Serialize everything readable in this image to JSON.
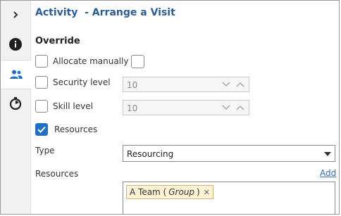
{
  "panel": {
    "title": "Activity  - Arrange a Visit",
    "section_title": "Override"
  },
  "rail": {
    "icons": [
      "chevron-right-icon",
      "info-icon",
      "people-icon",
      "stopwatch-icon"
    ],
    "active": "people-icon"
  },
  "override": {
    "allocate_manually": {
      "label": "Allocate manually",
      "checked": false
    },
    "security_level": {
      "label": "Security level",
      "checked": false,
      "value": "10"
    },
    "skill_level": {
      "label": "Skill level",
      "checked": false,
      "value": "10"
    },
    "resources": {
      "label": "Resources",
      "checked": true
    }
  },
  "type_field": {
    "label": "Type",
    "value": "Resourcing"
  },
  "resources_field": {
    "label": "Resources",
    "add_link": "Add",
    "items": [
      {
        "name": "A Team (",
        "group": "Group",
        "close": ")"
      }
    ]
  },
  "colors": {
    "accent": "#1e6fc8",
    "title": "#2a5c9a",
    "chip_bg": "#fdf3d4"
  }
}
